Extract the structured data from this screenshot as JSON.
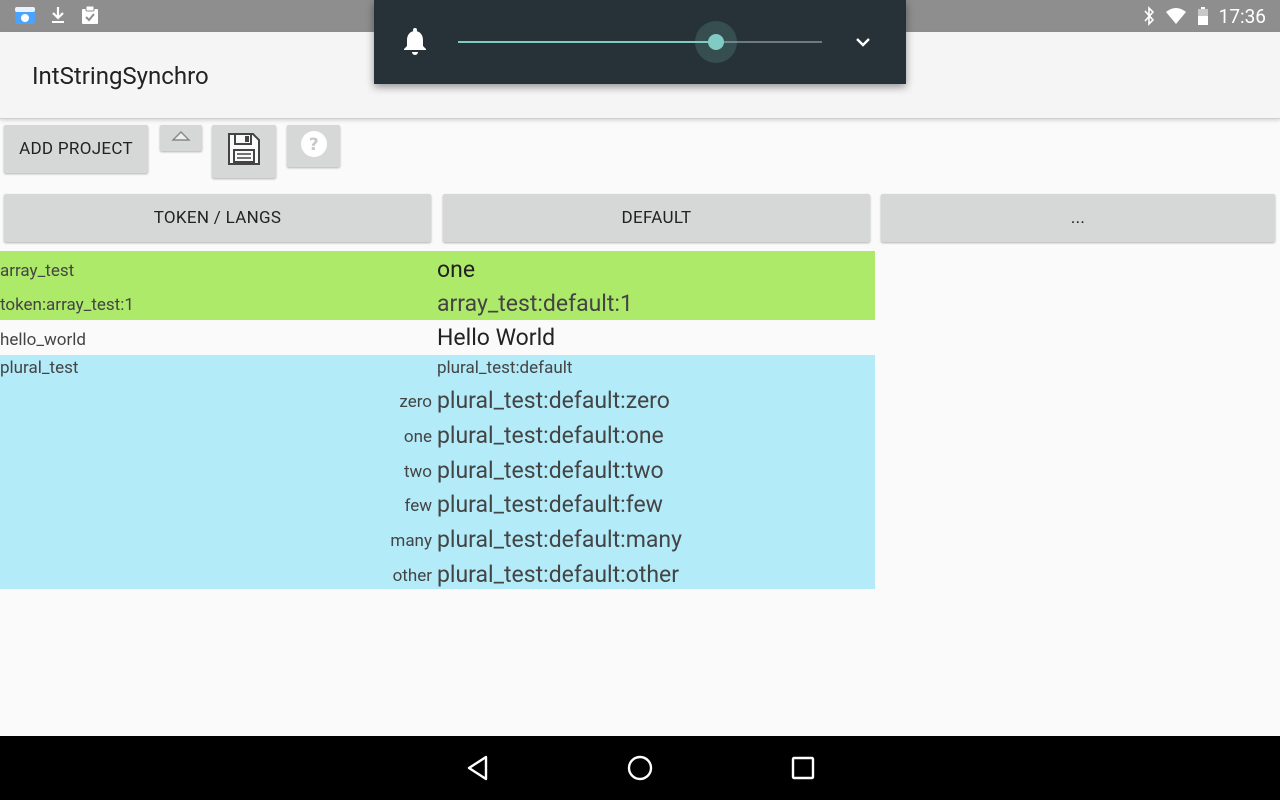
{
  "status_bar": {
    "time": "17:36",
    "left_icons": [
      "app-notification-icon",
      "download-icon",
      "clipboard-check-icon"
    ],
    "right_icons": [
      "bluetooth-icon",
      "wifi-icon",
      "battery-icon"
    ]
  },
  "app_title": "IntStringSynchro",
  "volume_panel": {
    "level": 0.71,
    "icon": "bell-icon",
    "expand_icon": "chevron-down-icon",
    "accent_color": "#80cbc4"
  },
  "toolbar": {
    "add_project_label": "ADD PROJECT",
    "up_icon": "arrow-up-icon",
    "save_icon": "floppy-disk-icon",
    "help_icon": "help-icon"
  },
  "headers": {
    "token_langs": "TOKEN / LANGS",
    "default": "DEFAULT",
    "more": "..."
  },
  "rows": {
    "array_test": {
      "token": "array_test",
      "value": "one",
      "sub_token": "token:array_test:1",
      "sub_value": "array_test:default:1"
    },
    "hello_world": {
      "token": "hello_world",
      "value": "Hello World"
    },
    "plural_test": {
      "token": "plural_test",
      "value": "plural_test:default",
      "quantities": [
        {
          "qty": "zero",
          "value": "plural_test:default:zero"
        },
        {
          "qty": "one",
          "value": "plural_test:default:one"
        },
        {
          "qty": "two",
          "value": "plural_test:default:two"
        },
        {
          "qty": "few",
          "value": "plural_test:default:few"
        },
        {
          "qty": "many",
          "value": "plural_test:default:many"
        },
        {
          "qty": "other",
          "value": "plural_test:default:other"
        }
      ]
    }
  },
  "colors": {
    "array_row": "#aeea6a",
    "plural_row": "#b3ebf9",
    "status_bar": "#8e8e8e",
    "volume_panel": "#263238"
  },
  "nav_bar": {
    "icons": [
      "back-icon",
      "home-icon",
      "recents-icon"
    ]
  }
}
